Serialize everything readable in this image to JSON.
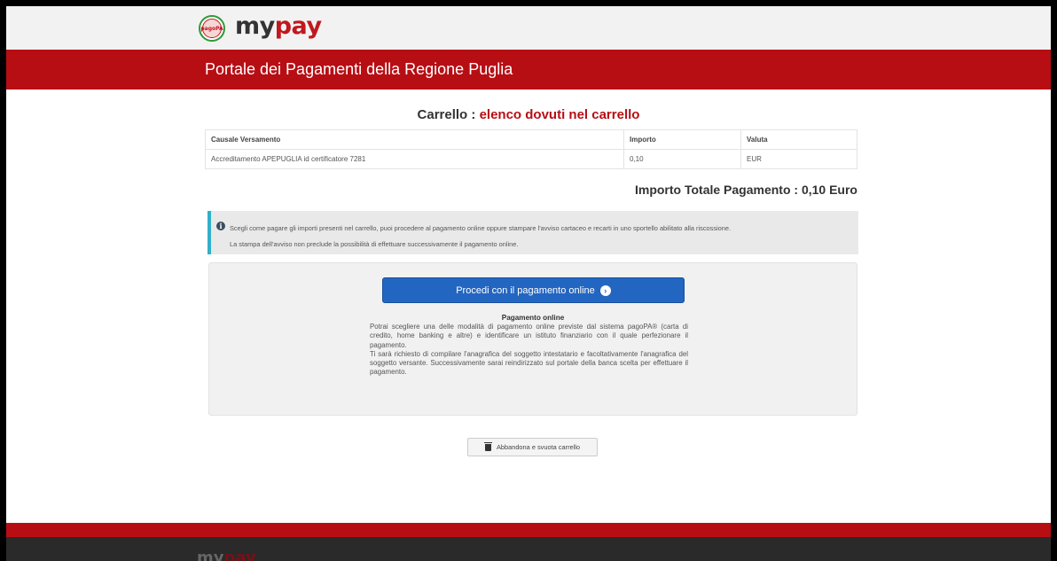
{
  "header": {
    "logo_pagopa": "pagoPA",
    "brand_my": "my",
    "brand_pay": "pay"
  },
  "banner": {
    "title": "Portale dei Pagamenti della Regione Puglia"
  },
  "cart": {
    "title_prefix": "Carrello : ",
    "title_highlight": "elenco dovuti nel carrello",
    "columns": [
      "Causale Versamento",
      "Importo",
      "Valuta"
    ],
    "rows": [
      {
        "causale": "Accreditamento APEPUGLIA id certificatore 7281",
        "importo": "0,10",
        "valuta": "EUR"
      }
    ],
    "total": "Importo Totale Pagamento : 0,10 Euro"
  },
  "info": {
    "icon": "info-icon",
    "line1": "Scegli come pagare gli importi presenti nel carrello, puoi procedere al pagamento online oppure stampare l'avviso cartaceo e recarti in uno sportello abilitato alla riscossione.",
    "line2": "La stampa dell'avviso non preclude la possibilità di effettuare successivamente il pagamento online."
  },
  "payment": {
    "button_label": "Procedi con il pagamento online",
    "button_icon": "chevron-right-circle-icon",
    "heading": "Pagamento online",
    "desc1": "Potrai scegliere una delle modalità di pagamento online previste dal sistema pagoPA® (carta di credito, home banking e altre) e identificare un istituto finanziario con il quale perfezionare il pagamento.",
    "desc2": "Ti sarà richiesto di compilare l'anagrafica del soggetto intestatario e facoltativamente l'anagrafica del soggetto versante. Successivamente sarai reindirizzato sul portale della banca scelta per effettuare il pagamento."
  },
  "abandon": {
    "label": "Abbandona e svuota carrello",
    "icon": "trash-icon"
  },
  "footer": {
    "brand_my": "my",
    "brand_pay": "pay"
  },
  "colors": {
    "brand_red": "#b70e14",
    "button_blue": "#2366c2",
    "info_accent": "#31b0c9"
  }
}
